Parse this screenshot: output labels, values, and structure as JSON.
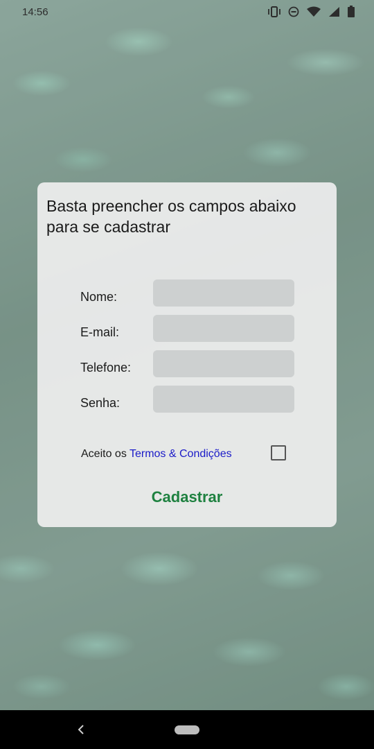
{
  "status_bar": {
    "time": "14:56",
    "icons": [
      "vibrate-icon",
      "do-not-disturb-icon",
      "wifi-icon",
      "signal-icon",
      "battery-icon"
    ]
  },
  "form": {
    "title": "Basta preencher os campos abaixo para se cadastrar",
    "fields": [
      {
        "label": "Nome:",
        "value": "",
        "placeholder": ""
      },
      {
        "label": "E-mail:",
        "value": "",
        "placeholder": ""
      },
      {
        "label": "Telefone:",
        "value": "",
        "placeholder": ""
      },
      {
        "label": "Senha:",
        "value": "",
        "placeholder": ""
      }
    ],
    "terms_prefix": "Aceito os ",
    "terms_link": "Termos & Condições",
    "terms_checked": false,
    "submit_label": "Cadastrar"
  },
  "colors": {
    "submit": "#1e8140",
    "link": "#1a1ac8",
    "input_bg": "#cdd0d0"
  },
  "nav_bar": {
    "icons": [
      "back-icon",
      "home-pill-icon"
    ]
  }
}
